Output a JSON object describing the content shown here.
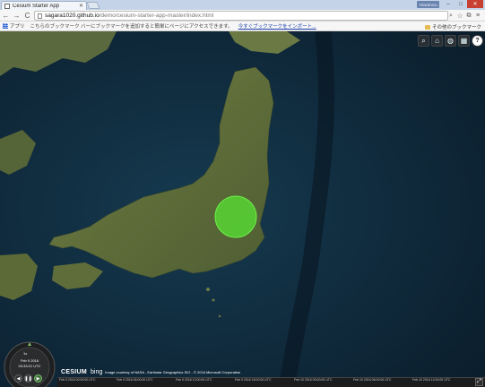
{
  "browser": {
    "tab_title": "Cesium Starter App",
    "profile_label": "TENSEIGU",
    "url_host": "sagara1020.github.io",
    "url_path": "/demo/cesium-starter-app-master/index.html"
  },
  "bookmarks": {
    "apps_label": "アプリ",
    "hint_text": "こちらのブックマーク バーにブックマークを追加すると簡単にページにアクセスできます。",
    "import_link": "今すぐブックマークをインポート...",
    "other_label": "その他のブックマーク"
  },
  "icons": [
    "search-icon",
    "home-icon",
    "globe-icon",
    "layers-icon",
    "help-icon",
    "star-icon",
    "menu-icon",
    "play-icon",
    "pause-icon",
    "rewind-icon",
    "fullscreen-icon"
  ],
  "viewer": {
    "marker_color": "#57d632",
    "ocean_color": "#0d2536",
    "land_color": "#6b7a45",
    "animation": {
      "speed": "1x",
      "date": "Feb 9 2016",
      "time": "03:33:21 UTC"
    },
    "credits": {
      "cesium_label": "CESIUM",
      "bing_label": "bing",
      "text": "Image courtesy of NASA - Earthstar Geographics SIO - © 2016 Microsoft Corporation"
    },
    "timeline_ticks": [
      "Feb 9 2016 00:00:00 UTC",
      "Feb 9 2016 06:00:00 UTC",
      "Feb 9 2016 12:00:00 UTC",
      "Feb 9 2016 18:00:00 UTC",
      "Feb 10 2016 00:00:00 UTC",
      "Feb 10 2016 06:00:00 UTC",
      "Feb 10 2016 12:00:00 UTC"
    ]
  }
}
